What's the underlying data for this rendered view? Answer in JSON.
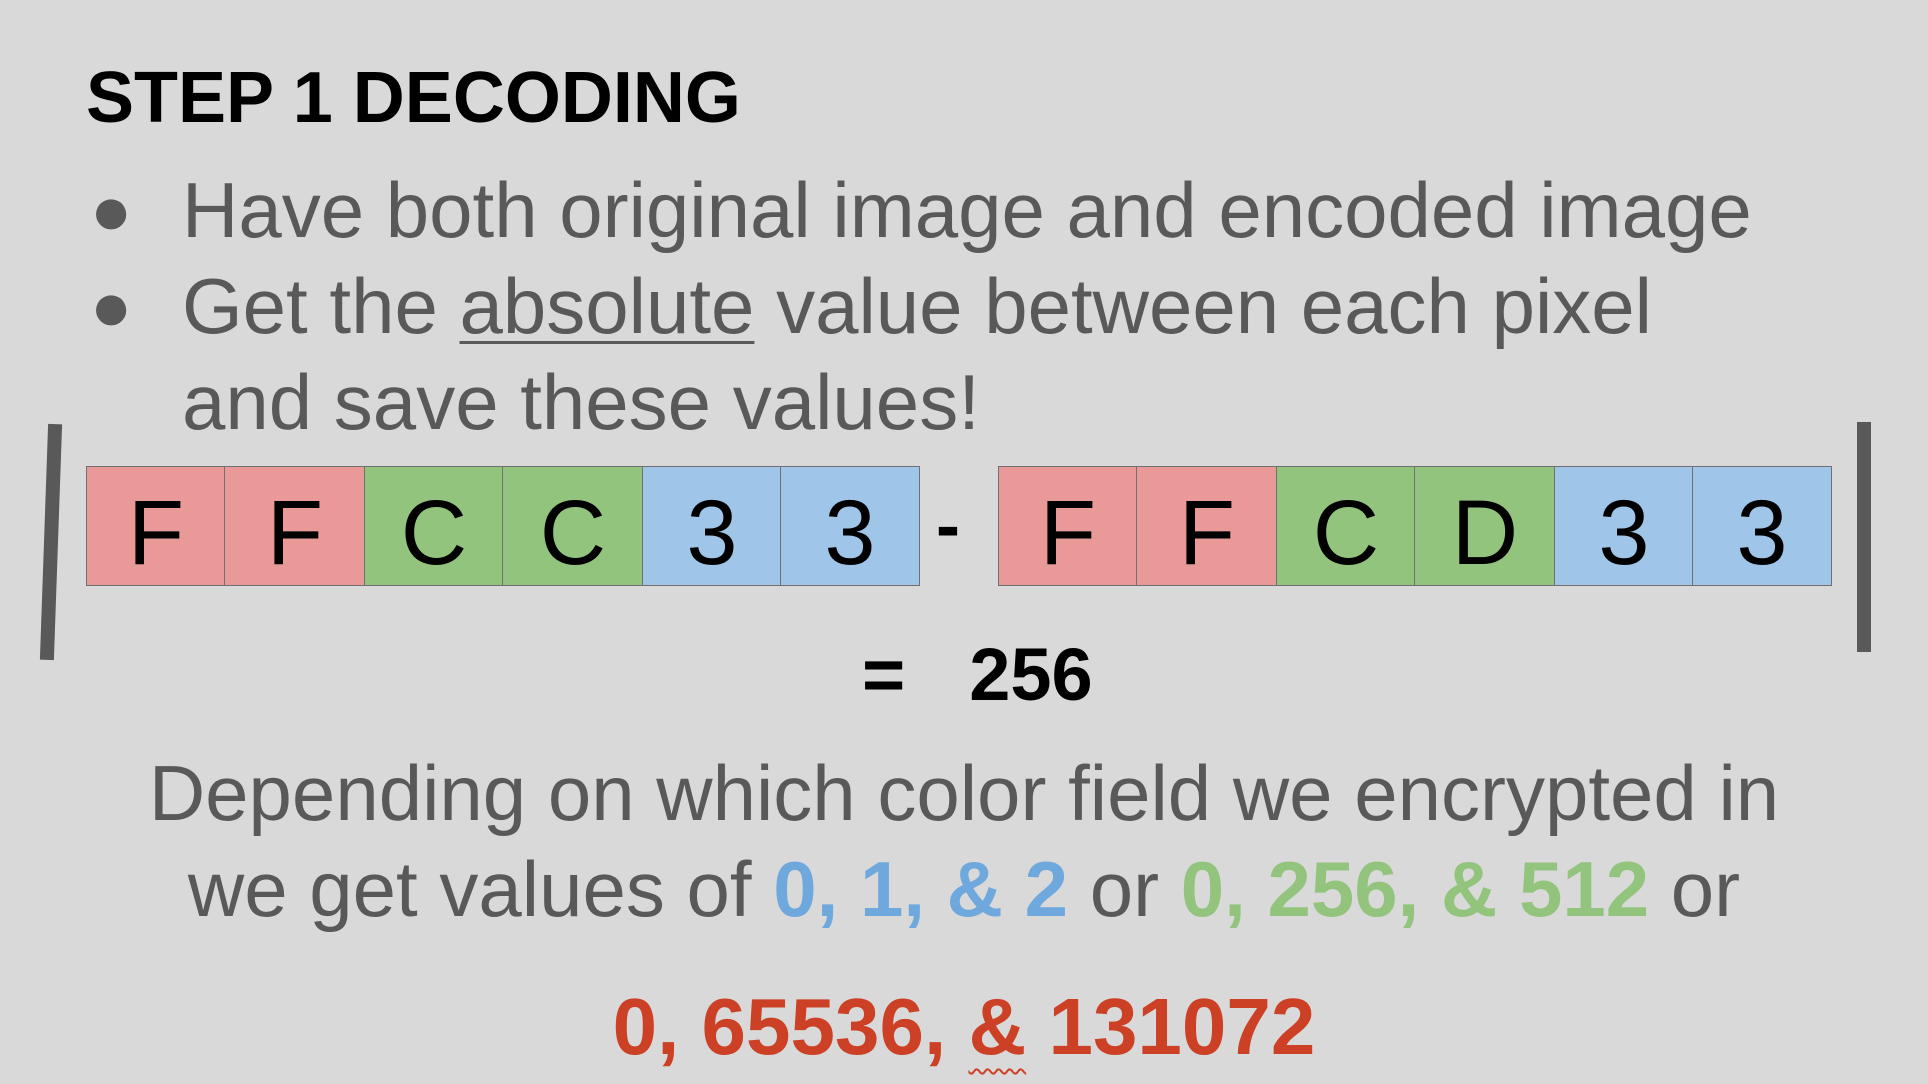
{
  "title": "STEP 1 DECODING",
  "bullets": [
    {
      "text": "Have both original image and encoded image"
    },
    {
      "pre": "Get the ",
      "underlined": "absolute",
      "post": " value between each pixel",
      "line2": "and save these values!"
    }
  ],
  "bullet_glyph": "●",
  "left_hex": [
    "F",
    "F",
    "C",
    "C",
    "3",
    "3"
  ],
  "right_hex": [
    "F",
    "F",
    "C",
    "D",
    "3",
    "3"
  ],
  "operator": "-",
  "equals": "=",
  "result": "256",
  "body_line1": "Depending on which color field we encrypted in",
  "body_line2": {
    "pre": "we get values of ",
    "blue": "0, 1, & 2",
    "or1": " or ",
    "green": "0, 256, & 512",
    "or2": " or"
  },
  "final": {
    "a": "0, 65536, ",
    "amp": "&",
    "b": " 131072"
  },
  "colors": {
    "red_cell": "#ea9999",
    "green_cell": "#93c47d",
    "blue_cell": "#9fc5e8",
    "blue_text": "#6fa8dc",
    "green_text": "#93c47d",
    "red_text": "#cc4125",
    "body_text": "#595959"
  }
}
